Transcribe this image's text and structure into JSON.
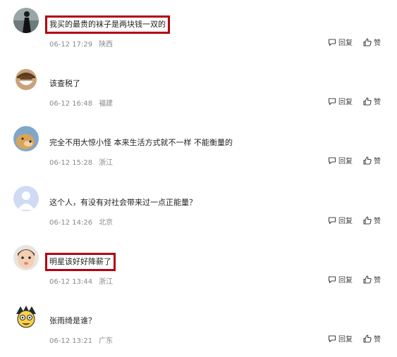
{
  "actions": {
    "reply_label": "回复",
    "like_label": "赞"
  },
  "comments": [
    {
      "text": "我买的最贵的袜子是两块钱一双的",
      "time": "06-12 17:29",
      "location": "陕西",
      "highlighted": true,
      "avatar": "dark-figure-avatar"
    },
    {
      "text": "该查税了",
      "time": "06-12 16:48",
      "location": "福建",
      "highlighted": false,
      "avatar": "masked-face-avatar"
    },
    {
      "text": "完全不用大惊小怪 本来生活方式就不一样 不能衡量的",
      "time": "06-12 15:28",
      "location": "浙江",
      "highlighted": false,
      "avatar": "dog-avatar"
    },
    {
      "text": "这个人，有没有对社会带来过一点正能量？",
      "time": "06-12 14:26",
      "location": "北京",
      "highlighted": false,
      "avatar": "default-user-avatar"
    },
    {
      "text": "明星该好好降薪了",
      "time": "06-12 13:44",
      "location": "浙江",
      "highlighted": true,
      "avatar": "baby-avatar"
    },
    {
      "text": "张雨绮是谁？",
      "time": "06-12 13:21",
      "location": "广东",
      "highlighted": false,
      "avatar": "cartoon-boy-avatar"
    }
  ]
}
